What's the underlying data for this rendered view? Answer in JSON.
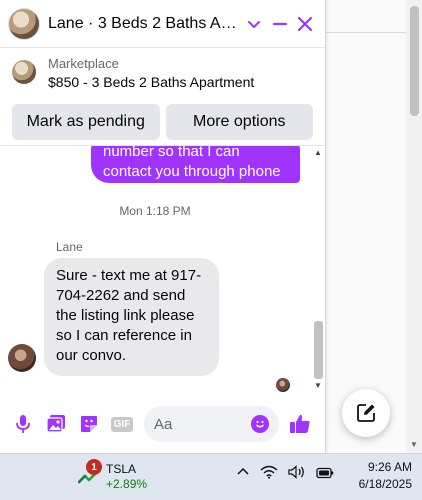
{
  "chat": {
    "title": "Lane · 3 Beds 2 Baths Apar…",
    "marketplace_label": "Marketplace",
    "listing": "$850 - 3 Beds 2 Baths Apartment",
    "actions": {
      "mark_pending": "Mark as pending",
      "more_options": "More options"
    },
    "outgoing_message": "number so that I can contact you through phone",
    "timestamp": "Mon 1:18 PM",
    "sender_name": "Lane",
    "incoming_message": "Sure - text me at 917-704-2262 and send the listing link please so I can reference in our convo.",
    "composer_placeholder": "Aa",
    "gif_label": "GIF",
    "accent_color": "#a033ff"
  },
  "taskbar": {
    "stock_symbol": "TSLA",
    "stock_change": "+2.89%",
    "notification_count": "1",
    "time": "9:26 AM",
    "date": "6/18/2025"
  }
}
